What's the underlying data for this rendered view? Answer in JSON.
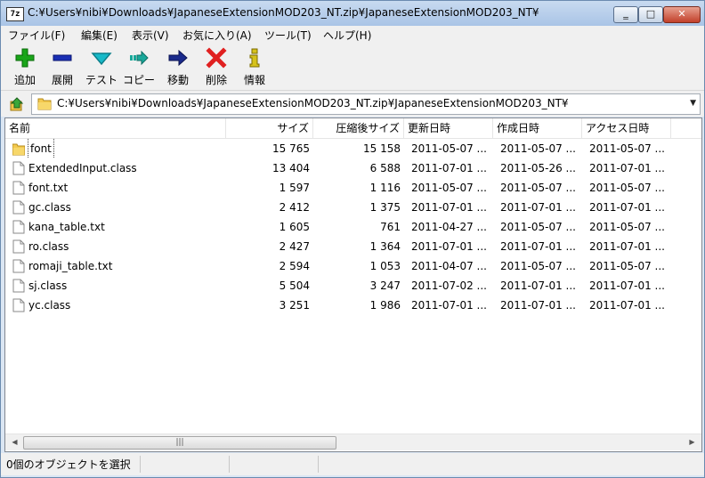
{
  "window": {
    "title_icon": "7z",
    "title": "C:¥Users¥nibi¥Downloads¥JapaneseExtensionMOD203_NT.zip¥JapaneseExtensionMOD203_NT¥",
    "close_glyph": "✕",
    "min_glyph": "‗",
    "max_glyph": "□"
  },
  "menu": [
    {
      "label": "ファイル(F)"
    },
    {
      "label": "編集(E)"
    },
    {
      "label": "表示(V)"
    },
    {
      "label": "お気に入り(A)"
    },
    {
      "label": "ツール(T)"
    },
    {
      "label": "ヘルプ(H)"
    }
  ],
  "toolbar": [
    {
      "label": "追加",
      "icon": "plus-icon",
      "color": "#1aa51a"
    },
    {
      "label": "展開",
      "icon": "minus-icon",
      "color": "#1a2fb4"
    },
    {
      "label": "テスト",
      "icon": "check-icon",
      "color": "#18b9c8"
    },
    {
      "label": "コピー",
      "icon": "copy-arrow-icon",
      "color": "#18a89a"
    },
    {
      "label": "移動",
      "icon": "move-arrow-icon",
      "color": "#1a2a8c"
    },
    {
      "label": "削除",
      "icon": "delete-x-icon",
      "color": "#e02020"
    },
    {
      "label": "情報",
      "icon": "info-icon",
      "color": "#d6c21a"
    }
  ],
  "address": {
    "path": "C:¥Users¥nibi¥Downloads¥JapaneseExtensionMOD203_NT.zip¥JapaneseExtensionMOD203_NT¥"
  },
  "columns": {
    "name": "名前",
    "size": "サイズ",
    "packed": "圧縮後サイズ",
    "modified": "更新日時",
    "created": "作成日時",
    "accessed": "アクセス日時"
  },
  "files": [
    {
      "name": "font",
      "type": "folder",
      "size": "15 765",
      "packed": "15 158",
      "modified": "2011-05-07 ...",
      "created": "2011-05-07 ...",
      "accessed": "2011-05-07 ..."
    },
    {
      "name": "ExtendedInput.class",
      "type": "file",
      "size": "13 404",
      "packed": "6 588",
      "modified": "2011-07-01 ...",
      "created": "2011-05-26 ...",
      "accessed": "2011-07-01 ..."
    },
    {
      "name": "font.txt",
      "type": "file",
      "size": "1 597",
      "packed": "1 116",
      "modified": "2011-05-07 ...",
      "created": "2011-05-07 ...",
      "accessed": "2011-05-07 ..."
    },
    {
      "name": "gc.class",
      "type": "file",
      "size": "2 412",
      "packed": "1 375",
      "modified": "2011-07-01 ...",
      "created": "2011-07-01 ...",
      "accessed": "2011-07-01 ..."
    },
    {
      "name": "kana_table.txt",
      "type": "file",
      "size": "1 605",
      "packed": "761",
      "modified": "2011-04-27 ...",
      "created": "2011-05-07 ...",
      "accessed": "2011-05-07 ..."
    },
    {
      "name": "ro.class",
      "type": "file",
      "size": "2 427",
      "packed": "1 364",
      "modified": "2011-07-01 ...",
      "created": "2011-07-01 ...",
      "accessed": "2011-07-01 ..."
    },
    {
      "name": "romaji_table.txt",
      "type": "file",
      "size": "2 594",
      "packed": "1 053",
      "modified": "2011-04-07 ...",
      "created": "2011-05-07 ...",
      "accessed": "2011-05-07 ..."
    },
    {
      "name": "sj.class",
      "type": "file",
      "size": "5 504",
      "packed": "3 247",
      "modified": "2011-07-02 ...",
      "created": "2011-07-01 ...",
      "accessed": "2011-07-01 ..."
    },
    {
      "name": "yc.class",
      "type": "file",
      "size": "3 251",
      "packed": "1 986",
      "modified": "2011-07-01 ...",
      "created": "2011-07-01 ...",
      "accessed": "2011-07-01 ..."
    }
  ],
  "scrollbar": {
    "left_glyph": "◀",
    "right_glyph": "▶",
    "grip": "|||"
  },
  "status": {
    "selection": "0個のオブジェクトを選択"
  }
}
